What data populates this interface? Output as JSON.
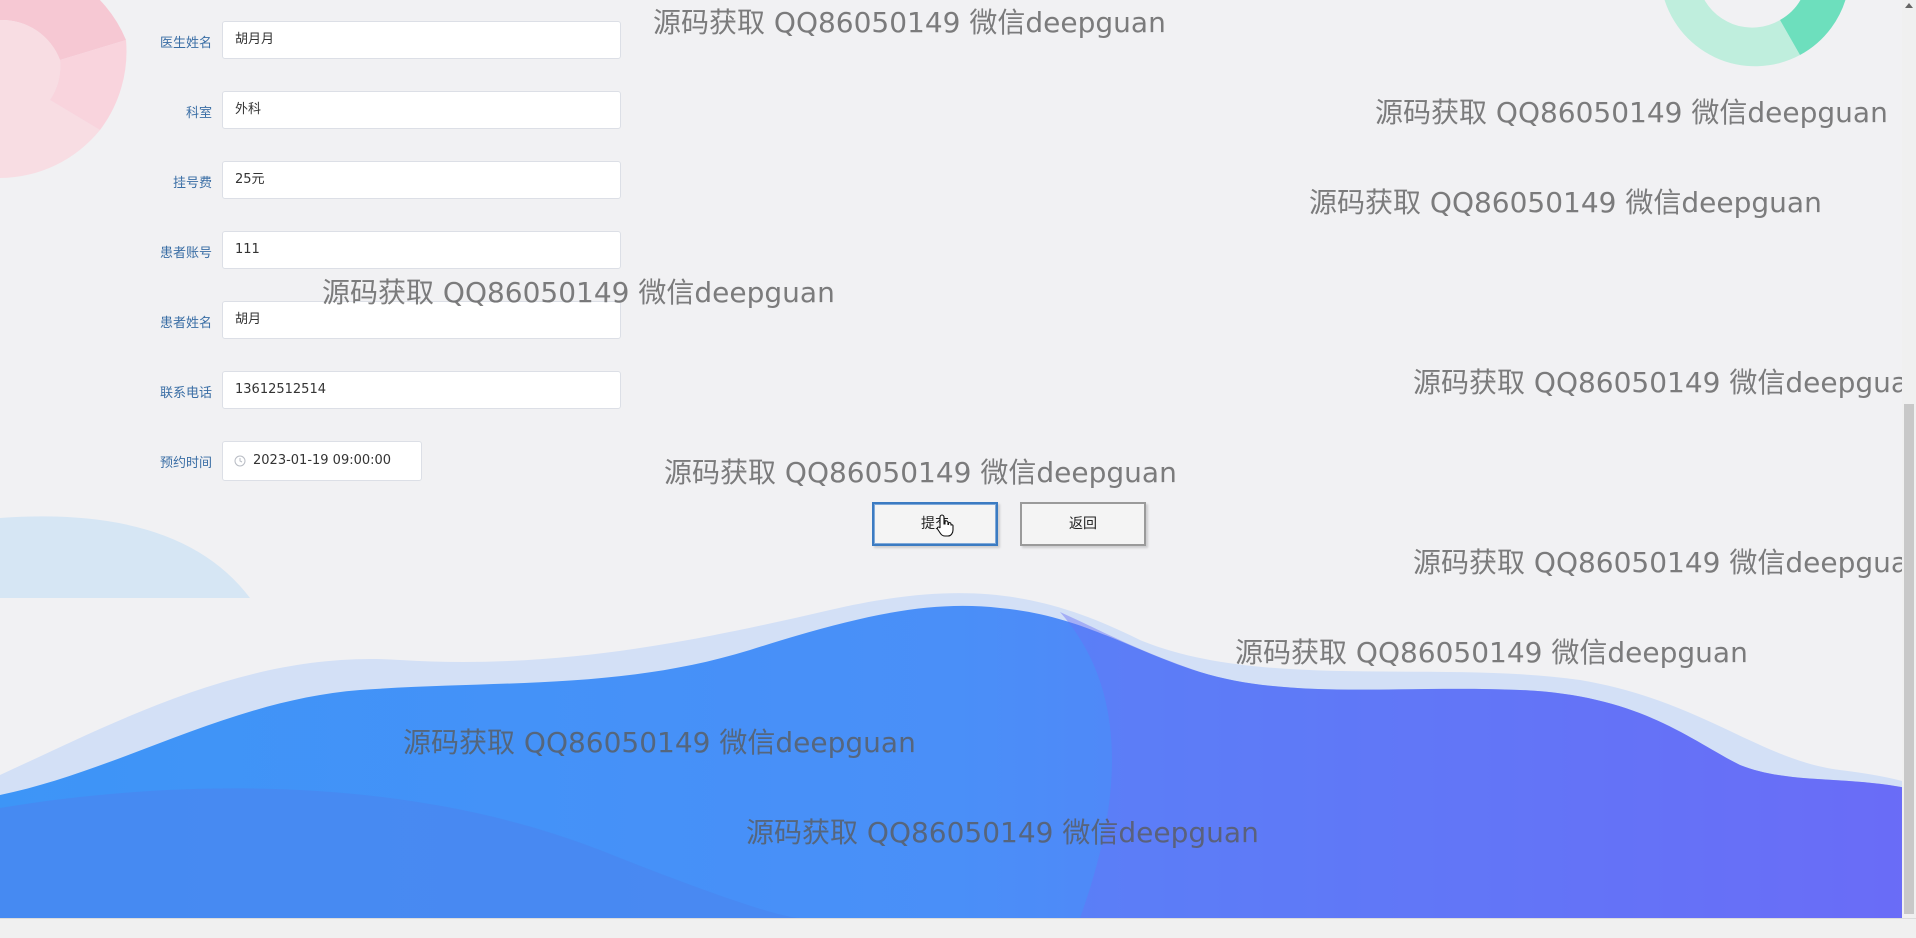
{
  "form": {
    "fields": [
      {
        "label": "医生姓名",
        "value": "胡月月"
      },
      {
        "label": "科室",
        "value": "外科"
      },
      {
        "label": "挂号费",
        "value": "25元"
      },
      {
        "label": "患者账号",
        "value": "111"
      },
      {
        "label": "患者姓名",
        "value": "胡月"
      },
      {
        "label": "联系电话",
        "value": "13612512514"
      }
    ],
    "appointment": {
      "label": "预约时间",
      "value": "2023-01-19 09:00:00"
    }
  },
  "actions": {
    "submit_label": "提交",
    "back_label": "返回"
  },
  "watermark": {
    "text": "源码获取 QQ86050149 微信deepguan"
  },
  "colors": {
    "background": "#f1f1f3",
    "label": "#3a6ea5",
    "wave_primary": "#4d8ff7",
    "wave_secondary": "#6b6cf7",
    "accent_green": "#66dfbd",
    "accent_pink": "#f6b4c4"
  },
  "icons": {
    "clock": "clock-icon",
    "cursor": "hand-pointer-icon"
  }
}
